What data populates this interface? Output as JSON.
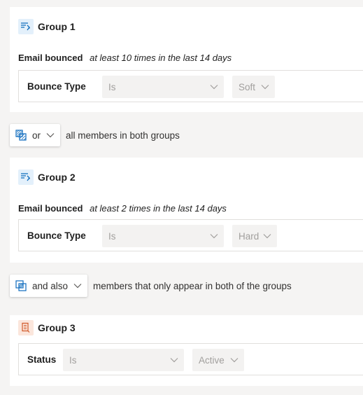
{
  "groups": [
    {
      "title": "Group 1",
      "condition": {
        "name": "Email bounced",
        "detail": "at least 10 times in the last 14 days"
      },
      "attribute": {
        "label": "Bounce Type",
        "operator": "Is",
        "value": "Soft"
      }
    },
    {
      "title": "Group 2",
      "condition": {
        "name": "Email bounced",
        "detail": "at least 2 times in the last 14 days"
      },
      "attribute": {
        "label": "Bounce Type",
        "operator": "Is",
        "value": "Hard"
      }
    },
    {
      "title": "Group 3",
      "attribute": {
        "label": "Status",
        "operator": "Is",
        "value": "Active"
      }
    }
  ],
  "connectors": [
    {
      "operator": "or",
      "description": "all members in both groups",
      "icon": "union-icon"
    },
    {
      "operator": "and also",
      "description": "members that only appear in both of the groups",
      "icon": "intersect-icon"
    }
  ],
  "colors": {
    "accent_blue": "#0f6cbd",
    "group_icon_blue_bg": "#e3f0fb",
    "group_icon_orange": "#d15a2a",
    "group_icon_orange_bg": "#fbe6dc"
  }
}
